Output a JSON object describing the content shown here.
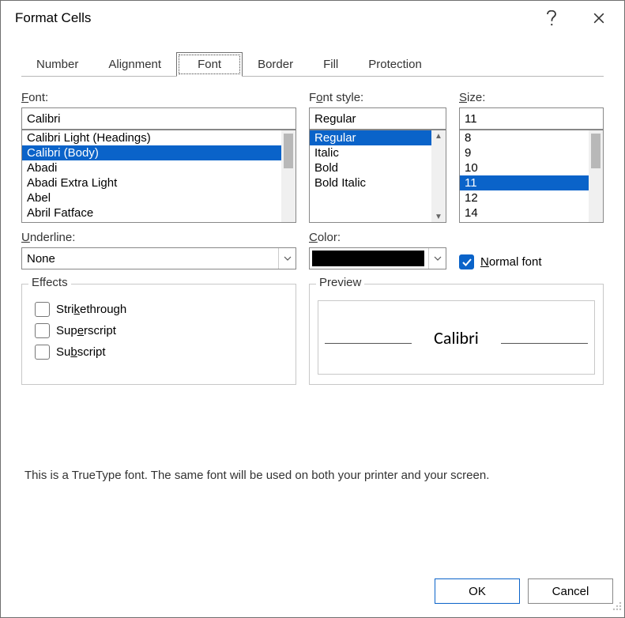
{
  "title": "Format Cells",
  "tabs": [
    "Number",
    "Alignment",
    "Font",
    "Border",
    "Fill",
    "Protection"
  ],
  "active_tab": "Font",
  "labels": {
    "font": "Font:",
    "style": "Font style:",
    "size": "Size:",
    "underline": "Underline:",
    "color": "Color:",
    "normal_font": "Normal font",
    "effects": "Effects",
    "strike": "Strikethrough",
    "superscript": "Superscript",
    "subscript": "Subscript",
    "preview": "Preview"
  },
  "font": {
    "value": "Calibri",
    "items": [
      "Calibri Light (Headings)",
      "Calibri (Body)",
      "Abadi",
      "Abadi Extra Light",
      "Abel",
      "Abril Fatface"
    ],
    "selected_index": 1
  },
  "style": {
    "value": "Regular",
    "items": [
      "Regular",
      "Italic",
      "Bold",
      "Bold Italic"
    ],
    "selected_index": 0
  },
  "size": {
    "value": "11",
    "items": [
      "8",
      "9",
      "10",
      "11",
      "12",
      "14"
    ],
    "selected_index": 3
  },
  "underline": {
    "value": "None"
  },
  "color": {
    "value": "#000000"
  },
  "normal_font_checked": true,
  "effects": {
    "strike": false,
    "superscript": false,
    "subscript": false
  },
  "preview_text": "Calibri",
  "hint": "This is a TrueType font.  The same font will be used on both your printer and your screen.",
  "buttons": {
    "ok": "OK",
    "cancel": "Cancel"
  }
}
